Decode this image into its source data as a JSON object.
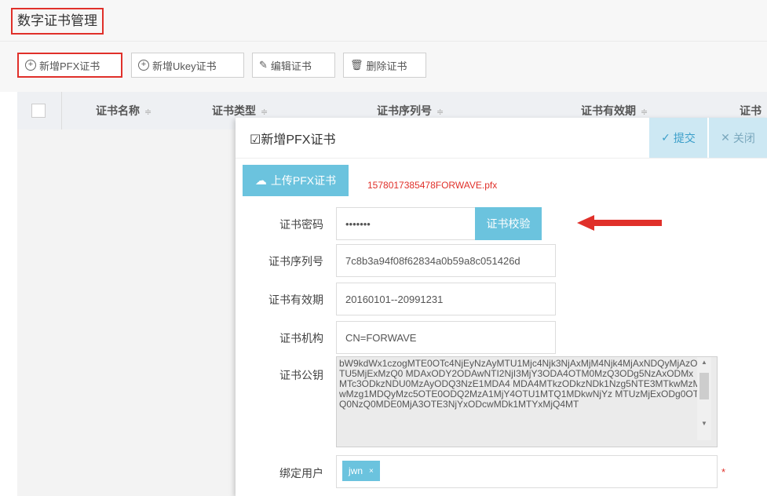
{
  "page": {
    "title": "数字证书管理"
  },
  "toolbar": {
    "add_pfx": "新增PFX证书",
    "add_ukey": "新增Ukey证书",
    "edit": "编辑证书",
    "delete": "删除证书"
  },
  "table": {
    "columns": [
      "证书名称",
      "证书类型",
      "证书序列号",
      "证书有效期",
      "证书"
    ],
    "sort_glyph": "≑"
  },
  "modal": {
    "title": "新增PFX证书",
    "submit": "提交",
    "close": "关闭",
    "upload": "上传PFX证书",
    "filename": "1578017385478FORWAVE.pfx",
    "verify": "证书校验",
    "fields": {
      "password": {
        "label": "证书密码",
        "value": "•••••••"
      },
      "serial": {
        "label": "证书序列号",
        "value": "7c8b3a94f08f62834a0b59a8c051426d"
      },
      "validity": {
        "label": "证书有效期",
        "value": "20160101--20991231"
      },
      "issuer": {
        "label": "证书机构",
        "value": "CN=FORWAVE"
      },
      "public_key": {
        "label": "证书公钥",
        "value": "bW9kdWx1czogMTE0OTc4NjEyNzAyMTU1Mjc4Njk3NjAxMjM4Njk4MjAxNDQyMjAzOTU5MjExMzQ0\nMDAxODY2ODAwNTI2NjI3MjY3ODA4OTM0MzQ3ODg5NzAxODMxMTc3ODkzNDU0MzAyODQ3NzE1MDA4\nMDA4MTkzODkzNDk1Nzg5NTE3MTkwMzMwMzg1MDQyMzc5OTE0ODQ2MzA1MjY4OTU1MTQ1MDkwNjYz\nMTUzMjExODg0OTQ0NzQ0MDE0MjA3OTE3NjYxODcwMDk1MTYxMjQ4MT"
      },
      "bind_user": {
        "label": "绑定用户",
        "tag": "jwn",
        "tag_remove": "×",
        "required": "*"
      }
    }
  },
  "colors": {
    "accent": "#6bc3de",
    "highlight": "#e0302a"
  }
}
